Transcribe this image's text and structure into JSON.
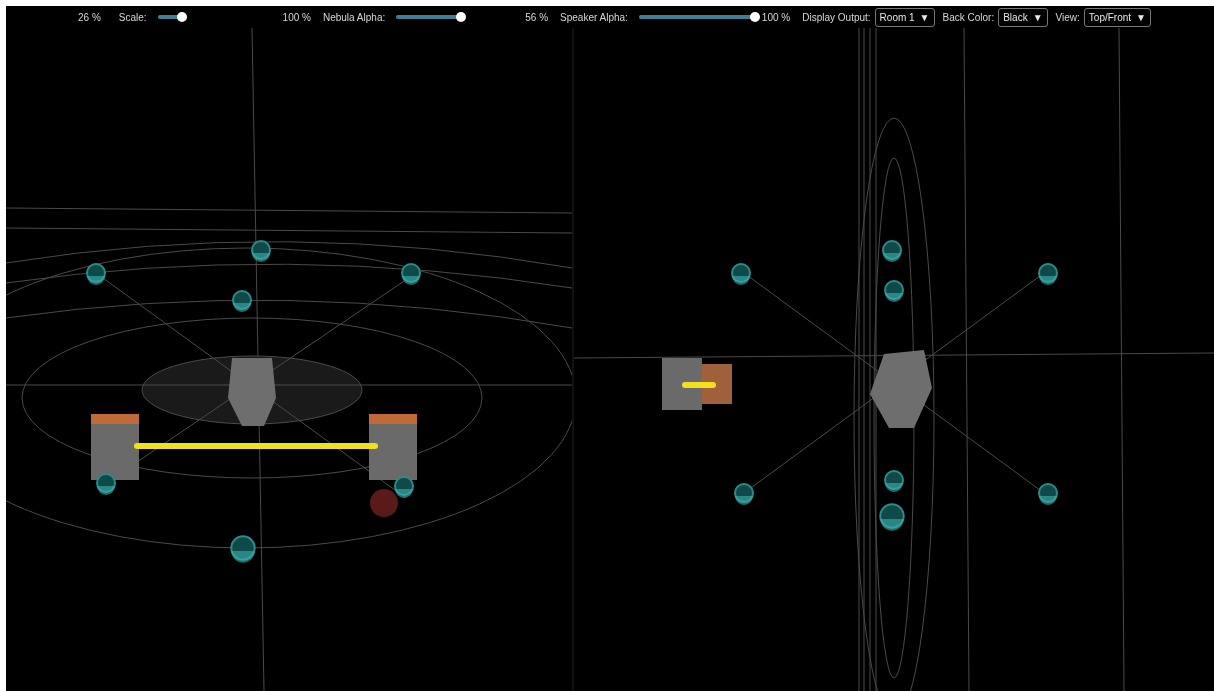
{
  "toolbar": {
    "leading_reading": "26 %",
    "sliders": [
      {
        "label": "Scale:",
        "level": 1,
        "reading": "100 %"
      },
      {
        "label": "Nebula Alpha:",
        "level": 0.93,
        "reading": "56 %"
      },
      {
        "label": "Speaker Alpha:",
        "level": 1,
        "reading": "100 %"
      }
    ],
    "dropdowns": [
      {
        "label": "Display Output:",
        "value": "Room 1"
      },
      {
        "label": "Back Color:",
        "value": "Black"
      },
      {
        "label": "View:",
        "value": "Top/Front"
      }
    ],
    "caret": "▼"
  }
}
